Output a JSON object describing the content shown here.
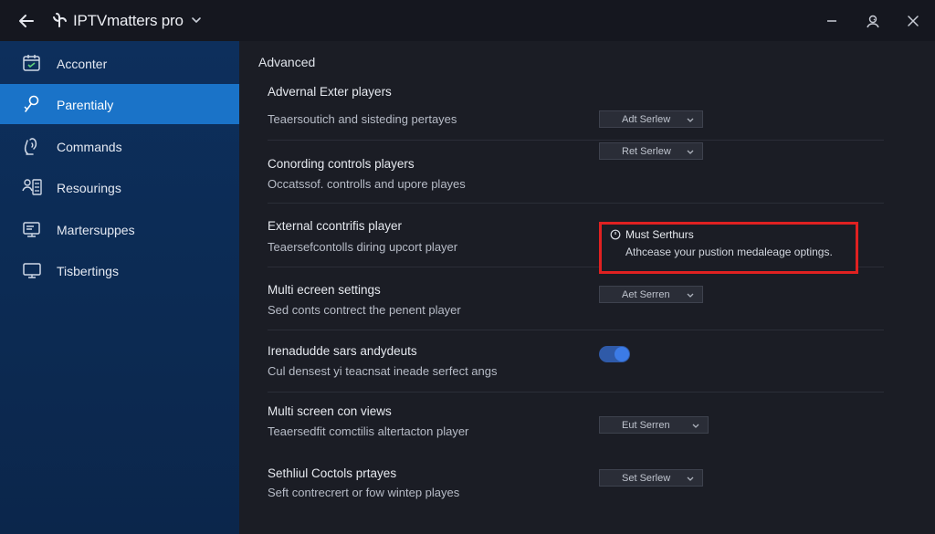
{
  "titlebar": {
    "app_title": "IPTVmatters pro",
    "back_icon": "arrow-left-icon",
    "logo_icon": "app-logo-icon",
    "dropdown_icon": "chevron-down-icon",
    "minimize_icon": "minimize-icon",
    "account_icon": "account-icon",
    "close_icon": "close-icon"
  },
  "sidebar": {
    "items": [
      {
        "label": "Acconter",
        "icon": "calendar-icon"
      },
      {
        "label": "Parentialy",
        "icon": "pin-icon"
      },
      {
        "label": "Commands",
        "icon": "hand-icon"
      },
      {
        "label": "Resourings",
        "icon": "people-list-icon"
      },
      {
        "label": "Martersuppes",
        "icon": "tv-icon"
      },
      {
        "label": "Tisbertings",
        "icon": "screen-icon"
      }
    ],
    "active_index": 1,
    "active_color": "#1a73c8"
  },
  "main": {
    "section_title": "Advanced",
    "rows": [
      {
        "title": "Advernal Exter players",
        "desc": "Teaersoutich and sisteding pertayes",
        "control": {
          "type": "select",
          "value": "Adt Serlew"
        }
      },
      {
        "title": "Conording controls players",
        "desc": "Occatssof. controlls and upore playes",
        "control": {
          "type": "select",
          "value": "Ret Serlew"
        }
      },
      {
        "title": "External ccontrifis player",
        "desc": "Teaersefcontolls diring upcort player"
      },
      {
        "title": "Multi ecreen settings",
        "desc": "Sed conts contrect the penent player",
        "control": {
          "type": "select",
          "value": "Aet Serren"
        }
      },
      {
        "title": "Irenadudde sars andydeuts",
        "desc": "Cul densest yi teacnsat ineade serfect angs",
        "control": {
          "type": "toggle",
          "on": true
        }
      },
      {
        "title": "Multi screen con views",
        "desc": "Teaersedfit comctilis altertacton player",
        "control": {
          "type": "select",
          "value": "Eut Serren"
        }
      },
      {
        "title": "Sethliul Coctols prtayes",
        "desc": "Seft contrecrert or fow wintep playes",
        "control": {
          "type": "select",
          "value": "Set Serlew"
        }
      }
    ],
    "tooltip": {
      "title": "Must Serthurs",
      "body": "Athcease your pustion medaleage optings.",
      "border_color": "#e02121",
      "icon": "info-circle-icon"
    }
  }
}
